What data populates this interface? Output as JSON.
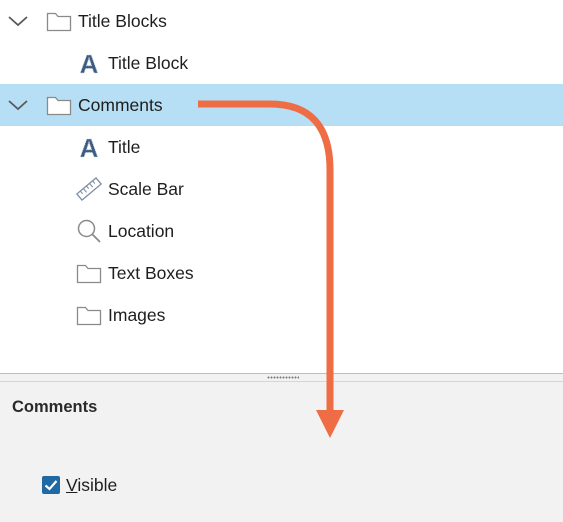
{
  "tree": {
    "items": [
      {
        "label": "Title Blocks",
        "icon": "folder-icon",
        "expanded": true
      },
      {
        "label": "Title Block",
        "icon": "text-a-icon"
      },
      {
        "label": "Comments",
        "icon": "folder-icon",
        "expanded": true,
        "selected": true
      },
      {
        "label": "Title",
        "icon": "text-a-icon"
      },
      {
        "label": "Scale Bar",
        "icon": "ruler-icon"
      },
      {
        "label": "Location",
        "icon": "magnifier-icon"
      },
      {
        "label": "Text Boxes",
        "icon": "folder-icon"
      },
      {
        "label": "Images",
        "icon": "folder-icon"
      }
    ]
  },
  "properties": {
    "title": "Comments",
    "visible_prefix": "V",
    "visible_rest": "isible",
    "visible_checked": true
  },
  "colors": {
    "selection": "#b6def5",
    "checkbox": "#1f6aa5",
    "arrow": "#ef6d45",
    "icon_a": "#3d5a80"
  }
}
